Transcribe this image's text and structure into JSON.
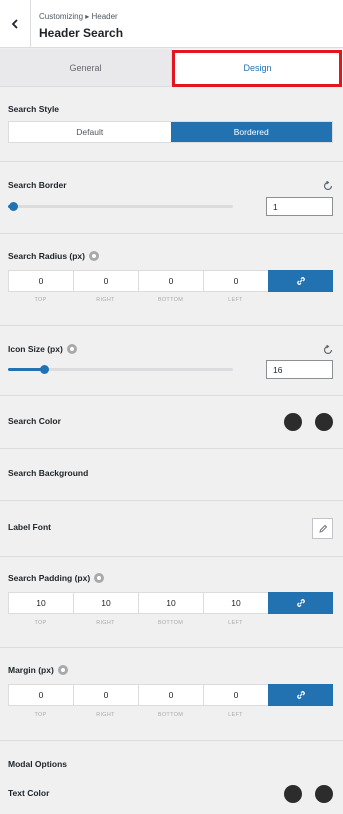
{
  "header": {
    "breadcrumb": "Customizing ▸ Header",
    "title": "Header Search"
  },
  "tabs": {
    "general": "General",
    "design": "Design"
  },
  "search_style": {
    "label": "Search Style",
    "options": [
      "Default",
      "Bordered"
    ],
    "selected": "Bordered"
  },
  "search_border": {
    "label": "Search Border",
    "value": "1",
    "slider_fraction": 0.02
  },
  "search_radius": {
    "label": "Search Radius (px)",
    "values": [
      "0",
      "0",
      "0",
      "0"
    ],
    "sides": [
      "TOP",
      "RIGHT",
      "BOTTOM",
      "LEFT"
    ]
  },
  "icon_size": {
    "label": "Icon Size (px)",
    "value": "16",
    "slider_fraction": 0.16
  },
  "search_color": {
    "label": "Search Color",
    "swatches": [
      "#2c2c2c",
      "#2c2c2c"
    ]
  },
  "search_background": {
    "label": "Search Background"
  },
  "label_font": {
    "label": "Label Font"
  },
  "search_padding": {
    "label": "Search Padding (px)",
    "values": [
      "10",
      "10",
      "10",
      "10"
    ],
    "sides": [
      "TOP",
      "RIGHT",
      "BOTTOM",
      "LEFT"
    ]
  },
  "margin": {
    "label": "Margin (px)",
    "values": [
      "0",
      "0",
      "0",
      "0"
    ],
    "sides": [
      "TOP",
      "RIGHT",
      "BOTTOM",
      "LEFT"
    ]
  },
  "modal_options": {
    "label": "Modal Options"
  },
  "text_color": {
    "label": "Text Color",
    "swatches": [
      "#2c2c2c",
      "#2c2c2c"
    ]
  },
  "colors": {
    "accent": "#2271b1",
    "highlight": "#e3161f"
  }
}
